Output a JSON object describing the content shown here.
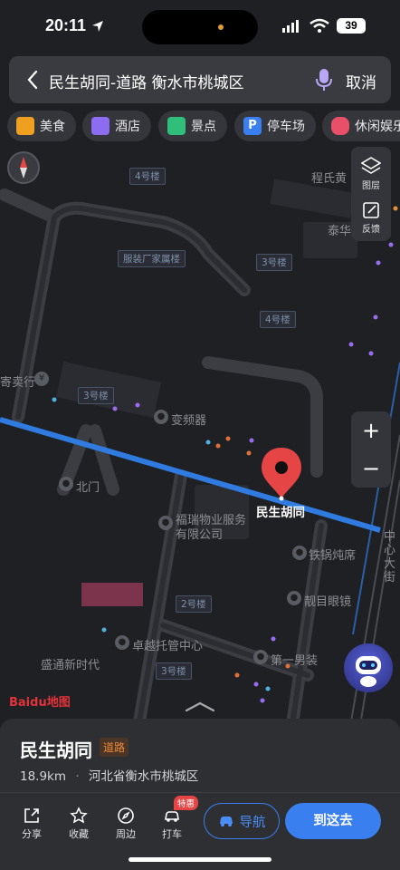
{
  "status_bar": {
    "time": "20:11",
    "battery": "39"
  },
  "search": {
    "query": "民生胡同-道路 衡水市桃城区",
    "cancel_label": "取消"
  },
  "categories": [
    {
      "label": "美食",
      "icon": "food-icon",
      "color": "#f0a020"
    },
    {
      "label": "酒店",
      "icon": "hotel-icon",
      "color": "#8c6cf0"
    },
    {
      "label": "景点",
      "icon": "scenic-icon",
      "color": "#2fbf7a"
    },
    {
      "label": "停车场",
      "icon": "parking-icon",
      "color": "#3a7ff0"
    },
    {
      "label": "休闲娱乐",
      "icon": "game-icon",
      "color": "#e8506a"
    }
  ],
  "tools": {
    "layers_label": "图层",
    "feedback_label": "反馈"
  },
  "zoom": {
    "in": "+",
    "out": "−"
  },
  "map": {
    "labels": [
      "程氏黄",
      "泰华",
      "服装厂家属楼",
      "4号楼",
      "3号楼",
      "4号楼",
      "3号楼",
      "变频器",
      "北门",
      "福瑞物业服务",
      "有限公司",
      "铁锅炖席",
      "靓目眼镜",
      "2号楼",
      "卓越托管中心",
      "盛通新时代",
      "3号楼",
      "第一男装",
      "寄卖行",
      "中心大街"
    ],
    "pin_label": "民生胡同",
    "logo": "Baidu地图"
  },
  "place": {
    "name": "民生胡同",
    "tag": "道路",
    "distance": "18.9km",
    "separator": "·",
    "address": "河北省衡水市桃城区"
  },
  "actions": [
    {
      "label": "分享",
      "icon": "share-icon"
    },
    {
      "label": "收藏",
      "icon": "star-icon"
    },
    {
      "label": "周边",
      "icon": "compass-icon"
    },
    {
      "label": "打车",
      "icon": "taxi-icon"
    }
  ],
  "taxi_badge": "特惠",
  "navigate_label": "导航",
  "go_label": "到这去",
  "colors": {
    "accent": "#3a7ff0",
    "road_highlight": "#2f7be0",
    "pin": "#e64545"
  }
}
